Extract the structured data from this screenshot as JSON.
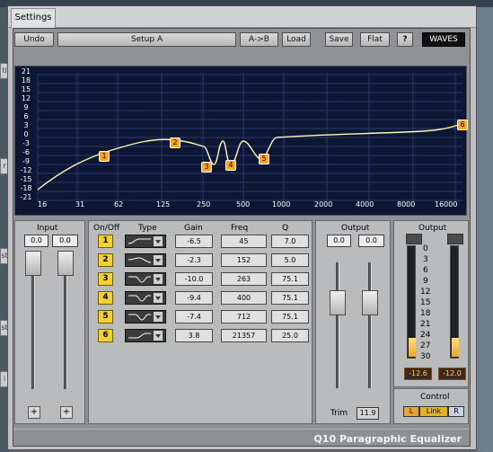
{
  "window": {
    "tab_label": "Settings",
    "plugin_name": "Q10 Paragraphic Equalizer"
  },
  "toolbar": {
    "undo": "Undo",
    "preset": "Setup A",
    "ab": "A->B",
    "load": "Load",
    "save": "Save",
    "flat": "Flat",
    "help": "?",
    "brand": "WAVES"
  },
  "graph": {
    "y_labels": [
      "21",
      "18",
      "15",
      "12",
      "9",
      "6",
      "3",
      "0",
      "-3",
      "-6",
      "-9",
      "-12",
      "-15",
      "-18",
      "-21"
    ],
    "x_labels": [
      "16",
      "31",
      "62",
      "125",
      "250",
      "500",
      "1000",
      "2000",
      "4000",
      "8000",
      "16000"
    ],
    "nodes": [
      "1",
      "2",
      "3",
      "4",
      "5",
      "6"
    ]
  },
  "input": {
    "title": "Input",
    "left_value": "0.0",
    "right_value": "0.0"
  },
  "bands": {
    "headers": [
      "On/Off",
      "Type",
      "Gain",
      "Freq",
      "Q"
    ],
    "rows": [
      {
        "num": "1",
        "gain": "-6.5",
        "freq": "45",
        "q": "7.0"
      },
      {
        "num": "2",
        "gain": "-2.3",
        "freq": "152",
        "q": "5.0"
      },
      {
        "num": "3",
        "gain": "-10.0",
        "freq": "263",
        "q": "75.1"
      },
      {
        "num": "4",
        "gain": "-9.4",
        "freq": "400",
        "q": "75.1"
      },
      {
        "num": "5",
        "gain": "-7.4",
        "freq": "712",
        "q": "75.1"
      },
      {
        "num": "6",
        "gain": "3.8",
        "freq": "21357",
        "q": "25.0"
      }
    ]
  },
  "output": {
    "title": "Output",
    "left_value": "0.0",
    "right_value": "0.0",
    "trim_label": "Trim",
    "trim_value": "11.9"
  },
  "meter": {
    "title": "Output",
    "scale": [
      "0",
      "3",
      "6",
      "9",
      "12",
      "15",
      "18",
      "21",
      "24",
      "27",
      "30"
    ],
    "left_peak": "-12.6",
    "right_peak": "-12.0",
    "left_level": 0.17,
    "right_level": 0.17
  },
  "control": {
    "title": "Control",
    "left": "L",
    "link": "Link",
    "right": "R"
  }
}
